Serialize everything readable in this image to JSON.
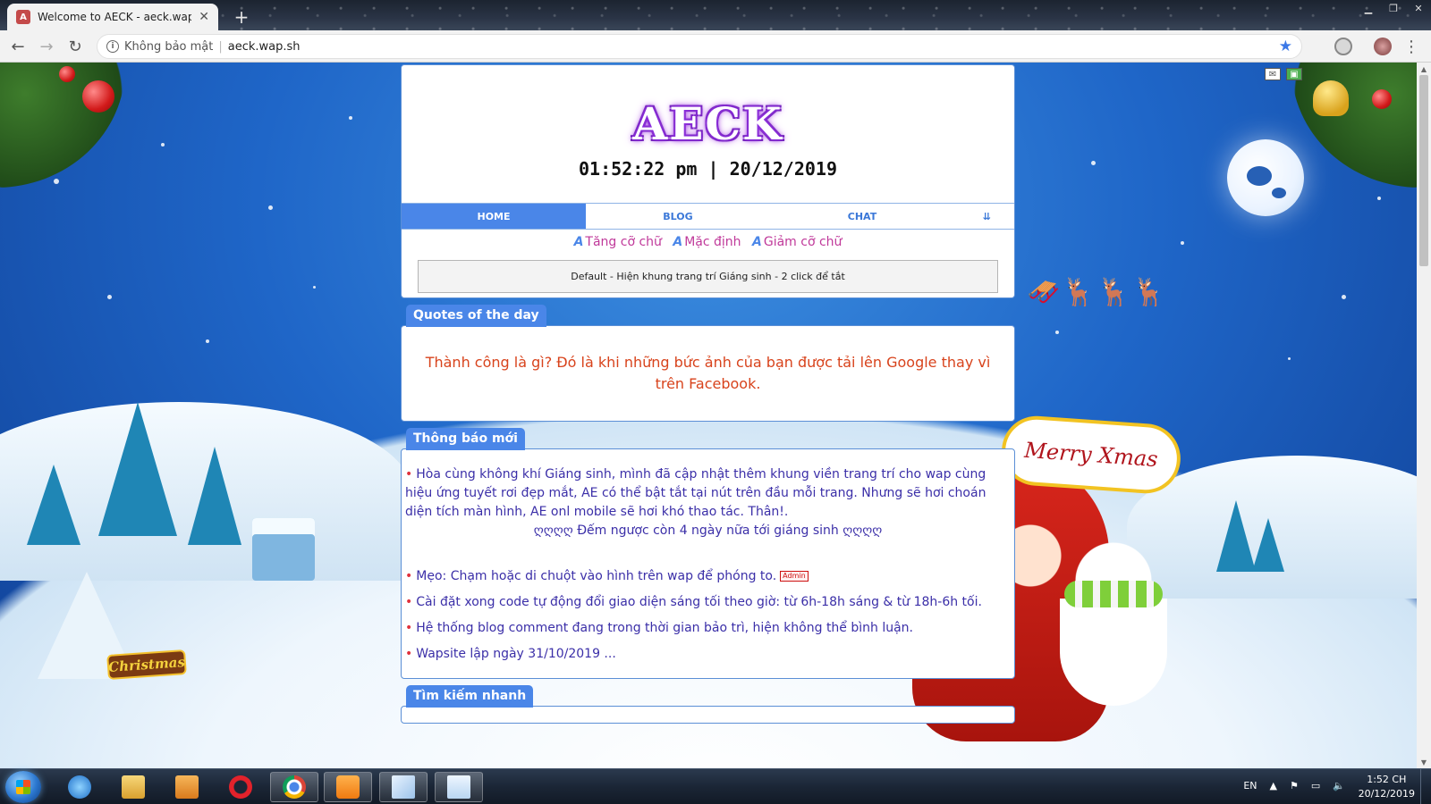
{
  "browser": {
    "tab_title": "Welcome to AECK - aeck.wap.sh",
    "favicon_text": "A",
    "new_tab_label": "+",
    "security_label": "Không bảo mật",
    "url": "aeck.wap.sh"
  },
  "site": {
    "logo": "AECK",
    "clock": "01:52:22 pm | 20/12/2019",
    "menu": [
      {
        "label": "HOME",
        "active": true
      },
      {
        "label": "BLOG",
        "active": false
      },
      {
        "label": "CHAT",
        "active": false
      },
      {
        "label": "⇊",
        "active": false
      }
    ],
    "font_controls": {
      "increase": "Tăng cỡ chữ",
      "default": "Mặc định",
      "decrease": "Giảm cỡ chữ"
    },
    "theme_bar": "Default - Hiện khung trang trí Giáng sinh - 2 click để tắt"
  },
  "quote": {
    "label": "Quotes of the day",
    "text": "Thành công là gì? Đó là khi những bức ảnh của bạn được tải lên Google thay vì trên Facebook."
  },
  "notice": {
    "label": "Thông báo mới",
    "intro": "Hòa cùng không khí Giáng sinh, mình đã cập nhật thêm khung viền trang trí cho wap cùng hiệu ứng tuyết rơi đẹp mắt, AE có thể bật tắt tại nút trên đầu mỗi trang. Nhưng sẽ hơi choán diện tích màn hình, AE onl mobile sẽ hơi khó thao tác. Thân!.",
    "countdown": "ღღღღ Đếm ngược còn 4 ngày nữa tới giáng sinh ღღღღ",
    "tip": "Mẹo: Chạm hoặc di chuột vào hình trên wap để phóng to.",
    "admin_tag": "Admin",
    "items": [
      "Cài đặt xong code tự động đổi giao diện sáng tối theo giờ: từ 6h-18h sáng & từ 18h-6h tối.",
      "Hệ thống blog comment đang trong thời gian bảo trì, hiện không thể bình luận.",
      "Wapsite lập ngày 31/10/2019 ..."
    ]
  },
  "search": {
    "label": "Tìm kiếm nhanh"
  },
  "decor": {
    "merry_sign": "Merry Xmas",
    "christmas_sign": "Christmas"
  },
  "taskbar": {
    "lang": "EN",
    "time": "1:52 CH",
    "date": "20/12/2019"
  },
  "colors": {
    "accent": "#4a86e8",
    "quote_text": "#d8431c",
    "notice_text": "#3b2fa8"
  }
}
